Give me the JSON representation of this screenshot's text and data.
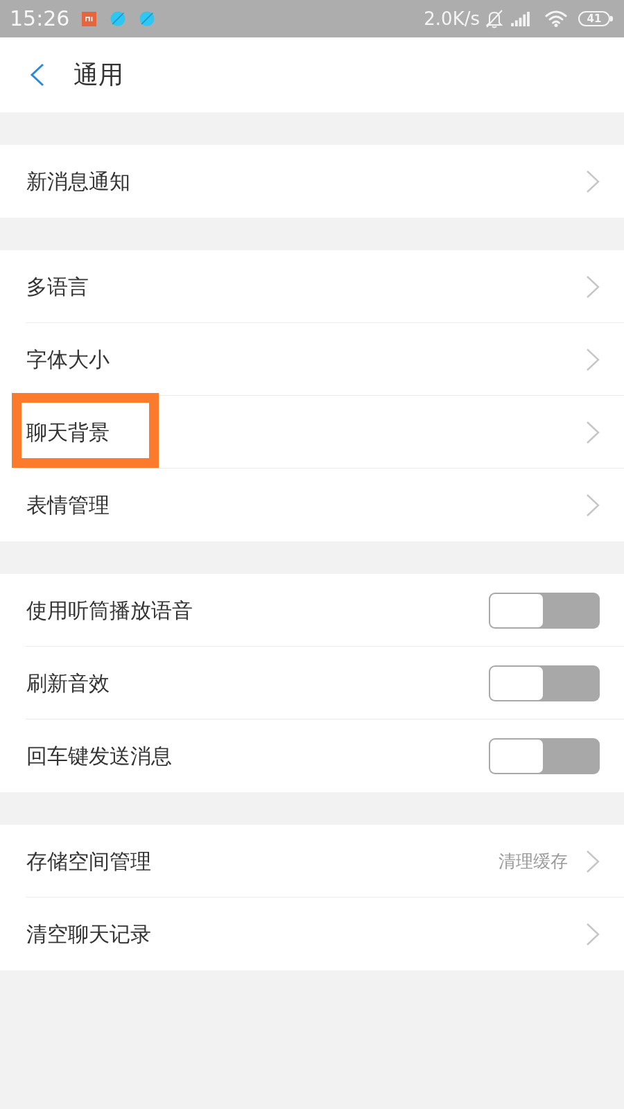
{
  "status_bar": {
    "time": "15:26",
    "network_speed": "2.0K/s",
    "battery": "41"
  },
  "header": {
    "title": "通用"
  },
  "sections": [
    {
      "items": [
        {
          "kind": "link",
          "label": "新消息通知",
          "highlighted": false
        }
      ]
    },
    {
      "items": [
        {
          "kind": "link",
          "label": "多语言",
          "highlighted": false
        },
        {
          "kind": "link",
          "label": "字体大小",
          "highlighted": false
        },
        {
          "kind": "link",
          "label": "聊天背景",
          "highlighted": true
        },
        {
          "kind": "link",
          "label": "表情管理",
          "highlighted": false
        }
      ]
    },
    {
      "items": [
        {
          "kind": "toggle",
          "label": "使用听筒播放语音",
          "on": false,
          "highlighted": false
        },
        {
          "kind": "toggle",
          "label": "刷新音效",
          "on": false,
          "highlighted": false
        },
        {
          "kind": "toggle",
          "label": "回车键发送消息",
          "on": false,
          "highlighted": false
        }
      ]
    },
    {
      "items": [
        {
          "kind": "link",
          "label": "存储空间管理",
          "value": "清理缓存",
          "highlighted": false
        },
        {
          "kind": "link",
          "label": "清空聊天记录",
          "highlighted": false
        }
      ]
    }
  ]
}
